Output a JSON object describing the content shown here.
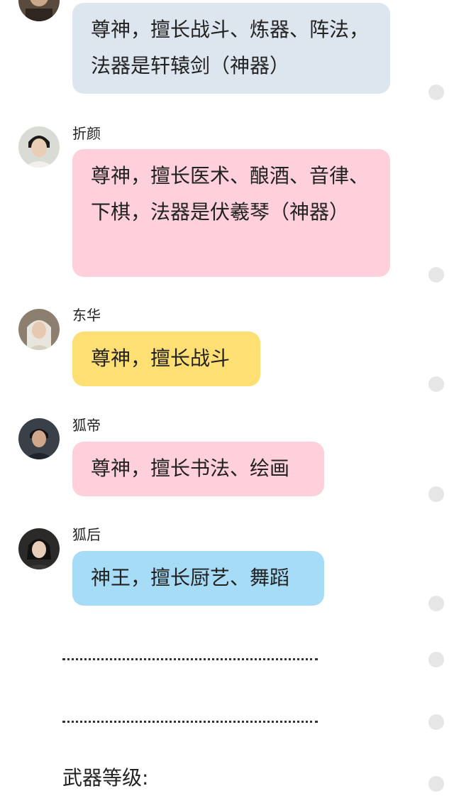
{
  "colors": {
    "bubble_gray_blue": "#dde6ee",
    "bubble_pink": "#fdd0dc",
    "bubble_yellow": "#fddf73",
    "bubble_light_blue": "#a7dcf7",
    "dot_gray": "#e6e6e6"
  },
  "messages": [
    {
      "sender": "",
      "avatar_icon": "portrait-partial-icon",
      "text": "尊神，擅长战斗、炼器、阵法，法器是轩辕剑（神器）"
    },
    {
      "sender": "折颜",
      "avatar_icon": "portrait-icon",
      "text": "尊神，擅长医术、酿酒、音律、下棋，法器是伏羲琴（神器）"
    },
    {
      "sender": "东华",
      "avatar_icon": "portrait-icon",
      "text": "尊神，擅长战斗"
    },
    {
      "sender": "狐帝",
      "avatar_icon": "portrait-icon",
      "text": "尊神，擅长书法、绘画"
    },
    {
      "sender": "狐后",
      "avatar_icon": "portrait-icon",
      "text": "神王，擅长厨艺、舞蹈"
    }
  ],
  "footer": {
    "text": "武器等级:"
  }
}
